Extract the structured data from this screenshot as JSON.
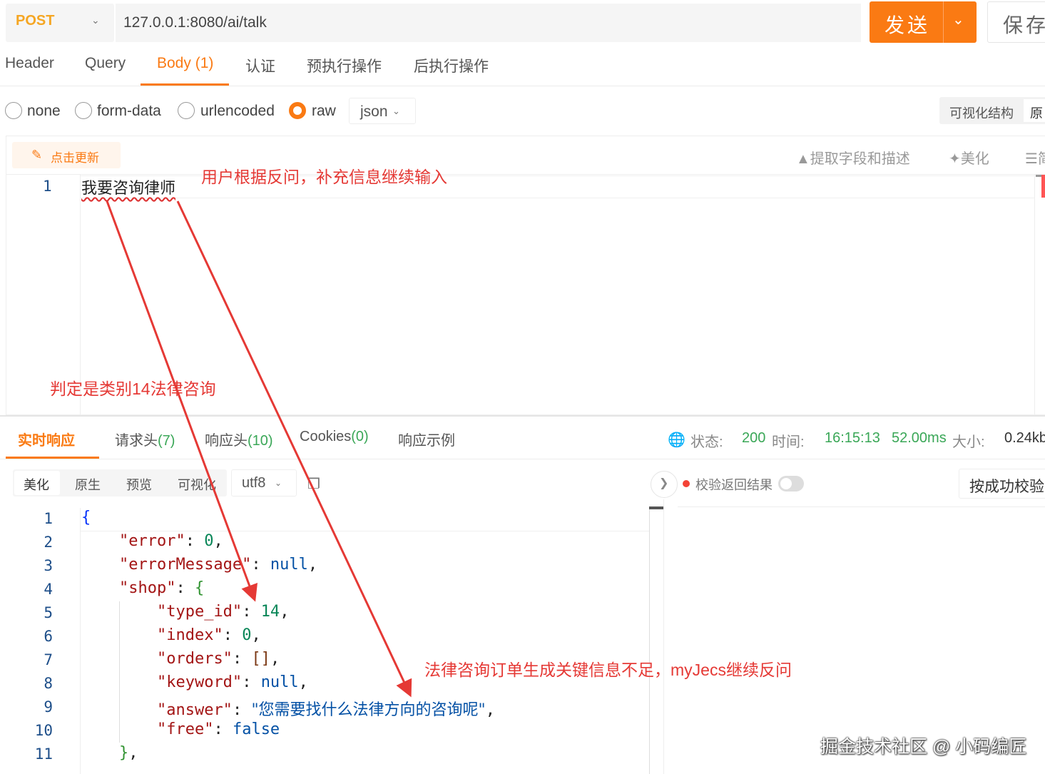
{
  "request": {
    "method": "POST",
    "url": "127.0.0.1:8080/ai/talk",
    "send_label": "发送",
    "save_label": "保存"
  },
  "request_tabs": [
    {
      "label": "Header"
    },
    {
      "label": "Query"
    },
    {
      "label": "Body",
      "count": "(1)",
      "active": true
    },
    {
      "label": "认证"
    },
    {
      "label": "预执行操作"
    },
    {
      "label": "后执行操作"
    }
  ],
  "body_types": [
    "none",
    "form-data",
    "urlencoded",
    "raw"
  ],
  "body_type_selected": "raw",
  "body_format": "json",
  "visual_structure_label": "可视化结构",
  "raw_tab_label": "原",
  "editor_toolbar": {
    "update_label": "点击更新",
    "extract_label": "提取字段和描述",
    "beautify_label": "美化",
    "more_label": "简"
  },
  "request_body": {
    "line_no": "1",
    "text": "我要咨询律师"
  },
  "annotations": {
    "user_followup": "用户根据反问，补充信息继续输入",
    "category": "判定是类别14法律咨询",
    "insufficient": "法律咨询订单生成关键信息不足，myJecs继续反问"
  },
  "response_tabs": [
    {
      "label": "实时响应",
      "active": true
    },
    {
      "label": "请求头",
      "count": "(7)"
    },
    {
      "label": "响应头",
      "count": "(10)"
    },
    {
      "label": "Cookies",
      "count": "(0)"
    },
    {
      "label": "响应示例"
    }
  ],
  "response_meta": {
    "status_label": "状态:",
    "status": "200",
    "time_label": "时间:",
    "time": "16:15:13",
    "duration": "52.00ms",
    "size_label": "大小:",
    "size": "0.24kb"
  },
  "response_toolbar": {
    "views": [
      "美化",
      "原生",
      "预览",
      "可视化"
    ],
    "encoding": "utf8",
    "validate_label": "校验返回结果",
    "success_check_label": "按成功校验"
  },
  "response_json": {
    "line_numbers": [
      "1",
      "2",
      "3",
      "4",
      "5",
      "6",
      "7",
      "8",
      "9",
      "10",
      "11"
    ],
    "error_key": "\"error\"",
    "error_value": "0",
    "errorMessage_key": "\"errorMessage\"",
    "errorMessage_value": "null",
    "shop_key": "\"shop\"",
    "type_id_key": "\"type_id\"",
    "type_id_value": "14",
    "index_key": "\"index\"",
    "index_value": "0",
    "orders_key": "\"orders\"",
    "orders_value": "[]",
    "keyword_key": "\"keyword\"",
    "keyword_value": "null",
    "answer_key": "\"answer\"",
    "answer_value": "\"您需要找什么法律方向的咨询呢\"",
    "free_key": "\"free\"",
    "free_value": "false"
  },
  "watermark": "掘金技术社区 @ 小码编匠",
  "colors": {
    "accent": "#fa7a13",
    "status_green": "#3aa757",
    "annotation_red": "#e53935"
  }
}
